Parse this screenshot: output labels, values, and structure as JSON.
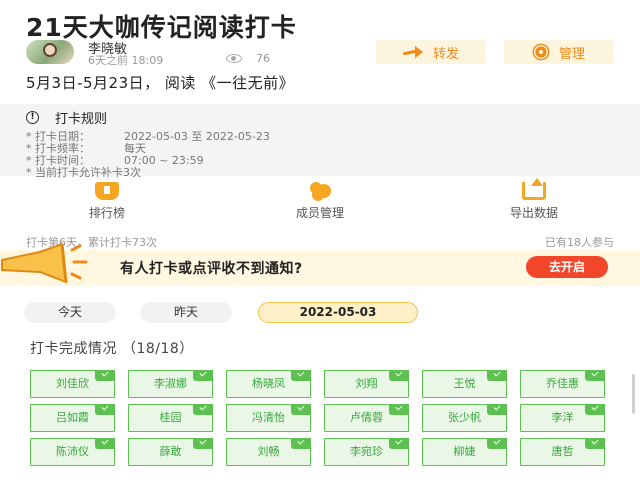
{
  "header": {
    "title": "21天大咖传记阅读打卡",
    "author_name": "李晓敏",
    "author_time": "6天之前 18:09",
    "views": "76",
    "share_label": "转发",
    "manage_label": "管理"
  },
  "subtitle": "5月3日-5月23日，  阅读 《一往无前》",
  "rules": {
    "heading": "打卡规则",
    "lines": [
      {
        "key": "* 打卡日期：",
        "value": "2022-05-03 至 2022-05-23"
      },
      {
        "key": "* 打卡频率：",
        "value": "每天"
      },
      {
        "key": "* 打卡时间：",
        "value": "07:00 ~ 23:59"
      },
      {
        "key": "* 当前打卡允许补卡3次",
        "value": ""
      }
    ]
  },
  "features": [
    {
      "label": "排行榜",
      "icon": "trophy-icon"
    },
    {
      "label": "成员管理",
      "icon": "members-icon"
    },
    {
      "label": "导出数据",
      "icon": "export-icon"
    }
  ],
  "stats": {
    "left": "打卡第6天，累计打卡73次",
    "right": "已有18人参与"
  },
  "notify": {
    "text": "有人打卡或点评收不到通知?",
    "button": "去开启"
  },
  "date_tabs": [
    "今天",
    "昨天",
    "2022-05-03"
  ],
  "complete": {
    "title": "打卡完成情况 （18/18）",
    "names": [
      "刘佳欣",
      "李淑娜",
      "杨晓凤",
      "刘翔",
      "王悦",
      "乔佳惠",
      "吕如霞",
      "桂园",
      "冯清怡",
      "卢倩蓉",
      "张少帆",
      "李洋",
      "陈沛仪",
      "薛敢",
      "刘畅",
      "李宛珍",
      "柳婕",
      "唐哲"
    ]
  },
  "colors": {
    "accent_orange": "#f08a1a",
    "check_green": "#5cc150",
    "notify_red": "#f2462b"
  }
}
